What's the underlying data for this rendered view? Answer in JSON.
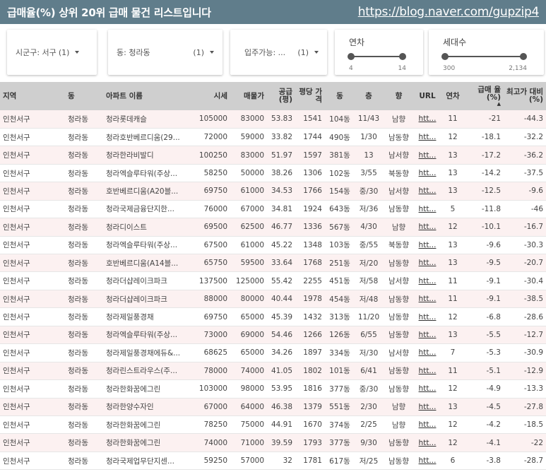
{
  "header": {
    "title": "급매율(%) 상위 20위 급매 물건 리스트입니다",
    "link": "https://blog.naver.com/gupzip4"
  },
  "filters": {
    "sigungu": {
      "label": "시군구: 서구",
      "count": "(1)"
    },
    "dong": {
      "label": "동: 청라동",
      "count": "(1)"
    },
    "ipju": {
      "label": "입주가능: ...",
      "count": "(1)"
    },
    "yeoncha": {
      "title": "연차",
      "min": "4",
      "max": "14"
    },
    "saedae": {
      "title": "세대수",
      "min": "300",
      "max": "2,134"
    }
  },
  "table": {
    "headers": [
      "지역",
      "동",
      "아파트 이름",
      "시세",
      "매물가",
      "공급 (평)",
      "평당 가격",
      "동",
      "층",
      "향",
      "URL",
      "연차",
      "급매 율(%)",
      "최고가 대비(%)"
    ],
    "sort_indicator": "▲",
    "rows": [
      [
        "인천서구",
        "청라동",
        "청라롯데캐슬",
        "105000",
        "83000",
        "53.83",
        "1541",
        "104동",
        "11/43",
        "남향",
        "htt...",
        "11",
        "-21",
        "-44.3"
      ],
      [
        "인천서구",
        "청라동",
        "청라호반베르디움(29...",
        "72000",
        "59000",
        "33.82",
        "1744",
        "490동",
        "1/30",
        "남동향",
        "htt...",
        "12",
        "-18.1",
        "-32.2"
      ],
      [
        "인천서구",
        "청라동",
        "청라한라비발디",
        "100250",
        "83000",
        "51.97",
        "1597",
        "381동",
        "13",
        "남서향",
        "htt...",
        "13",
        "-17.2",
        "-36.2"
      ],
      [
        "인천서구",
        "청라동",
        "청라엑슬루타워(주상...",
        "58250",
        "50000",
        "38.26",
        "1306",
        "102동",
        "3/55",
        "북동향",
        "htt...",
        "13",
        "-14.2",
        "-37.5"
      ],
      [
        "인천서구",
        "청라동",
        "호반베르디움(A20블...",
        "69750",
        "61000",
        "34.53",
        "1766",
        "154동",
        "중/30",
        "남서향",
        "htt...",
        "13",
        "-12.5",
        "-9.6"
      ],
      [
        "인천서구",
        "청라동",
        "청라국제금융단지한...",
        "76000",
        "67000",
        "34.81",
        "1924",
        "643동",
        "저/36",
        "남동향",
        "htt...",
        "5",
        "-11.8",
        "-46"
      ],
      [
        "인천서구",
        "청라동",
        "청라디이스트",
        "69500",
        "62500",
        "46.77",
        "1336",
        "567동",
        "4/30",
        "남향",
        "htt...",
        "12",
        "-10.1",
        "-16.7"
      ],
      [
        "인천서구",
        "청라동",
        "청라엑슬루타워(주상...",
        "67500",
        "61000",
        "45.22",
        "1348",
        "103동",
        "중/55",
        "북동향",
        "htt...",
        "13",
        "-9.6",
        "-30.3"
      ],
      [
        "인천서구",
        "청라동",
        "호반베르디움(A14블...",
        "65750",
        "59500",
        "33.64",
        "1768",
        "251동",
        "저/20",
        "남동향",
        "htt...",
        "13",
        "-9.5",
        "-20.7"
      ],
      [
        "인천서구",
        "청라동",
        "청라더샵레이크파크",
        "137500",
        "125000",
        "55.42",
        "2255",
        "451동",
        "저/58",
        "남서향",
        "htt...",
        "11",
        "-9.1",
        "-30.4"
      ],
      [
        "인천서구",
        "청라동",
        "청라더샵레이크파크",
        "88000",
        "80000",
        "40.44",
        "1978",
        "454동",
        "저/48",
        "남동향",
        "htt...",
        "11",
        "-9.1",
        "-38.5"
      ],
      [
        "인천서구",
        "청라동",
        "청라제일풍경채",
        "69750",
        "65000",
        "45.39",
        "1432",
        "313동",
        "11/20",
        "남동향",
        "htt...",
        "12",
        "-6.8",
        "-28.6"
      ],
      [
        "인천서구",
        "청라동",
        "청라엑슬루타워(주상...",
        "73000",
        "69000",
        "54.46",
        "1266",
        "126동",
        "6/55",
        "남동향",
        "htt...",
        "13",
        "-5.5",
        "-12.7"
      ],
      [
        "인천서구",
        "청라동",
        "청라제일풍경채에듀&...",
        "68625",
        "65000",
        "34.26",
        "1897",
        "334동",
        "저/30",
        "남서향",
        "htt...",
        "7",
        "-5.3",
        "-30.9"
      ],
      [
        "인천서구",
        "청라동",
        "청라린스트라우스(주...",
        "78000",
        "74000",
        "41.05",
        "1802",
        "101동",
        "6/41",
        "남동향",
        "htt...",
        "11",
        "-5.1",
        "-12.9"
      ],
      [
        "인천서구",
        "청라동",
        "청라한화꿈에그린",
        "103000",
        "98000",
        "53.95",
        "1816",
        "377동",
        "중/30",
        "남동향",
        "htt...",
        "12",
        "-4.9",
        "-13.3"
      ],
      [
        "인천서구",
        "청라동",
        "청라한양수자인",
        "67000",
        "64000",
        "46.38",
        "1379",
        "551동",
        "2/30",
        "남향",
        "htt...",
        "13",
        "-4.5",
        "-27.8"
      ],
      [
        "인천서구",
        "청라동",
        "청라한화꿈에그린",
        "78250",
        "75000",
        "44.91",
        "1670",
        "374동",
        "2/25",
        "남향",
        "htt...",
        "12",
        "-4.2",
        "-18.5"
      ],
      [
        "인천서구",
        "청라동",
        "청라한화꿈에그린",
        "74000",
        "71000",
        "39.59",
        "1793",
        "377동",
        "9/30",
        "남동향",
        "htt...",
        "12",
        "-4.1",
        "-22"
      ],
      [
        "인천서구",
        "청라동",
        "청라국제업무단지센...",
        "59250",
        "57000",
        "32",
        "1781",
        "617동",
        "저/25",
        "남동향",
        "htt...",
        "6",
        "-3.8",
        "-28.7"
      ]
    ]
  },
  "colors": {
    "header_bg": "#607d8b",
    "row_alt": "#fcf1f1",
    "thead_bg": "#cfcfcf"
  }
}
